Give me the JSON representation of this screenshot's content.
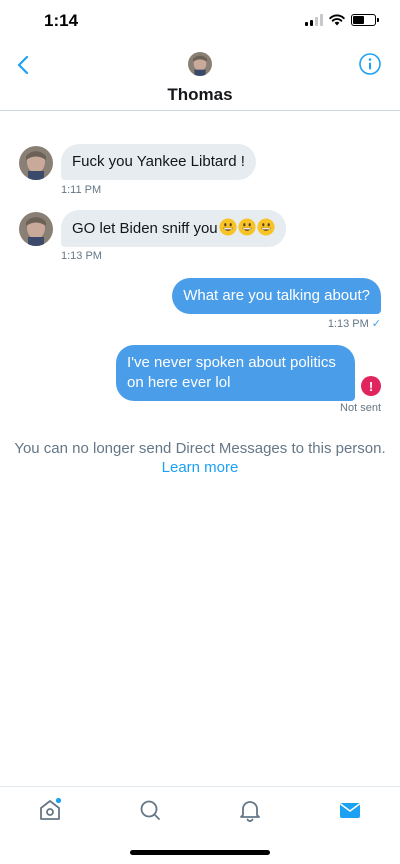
{
  "status_bar": {
    "time": "1:14"
  },
  "header": {
    "name": "Thomas"
  },
  "messages": [
    {
      "direction": "incoming",
      "text": "Fuck you Yankee Libtard !",
      "time": "1:11 PM"
    },
    {
      "direction": "incoming",
      "text": "GO let Biden sniff you",
      "emoji": [
        "grinning-face",
        "grinning-face",
        "grinning-face"
      ],
      "time": "1:13 PM"
    },
    {
      "direction": "outgoing",
      "text": "What are you talking about?",
      "time": "1:13 PM",
      "read_mark": "✓"
    },
    {
      "direction": "outgoing",
      "text": "I've never spoken about politics on here ever lol",
      "status": "Not sent"
    }
  ],
  "notice": {
    "text": "You can no longer send Direct Messages to this person.",
    "link": "Learn more"
  },
  "tab_bar": {
    "items": [
      "home-icon",
      "search-icon",
      "notifications-icon",
      "messages-icon"
    ],
    "active": "messages-icon"
  },
  "colors": {
    "accent": "#1da1f2",
    "outgoing_bubble": "#4a9de8",
    "incoming_bubble": "#e6ecf0",
    "error": "#e0245e"
  }
}
